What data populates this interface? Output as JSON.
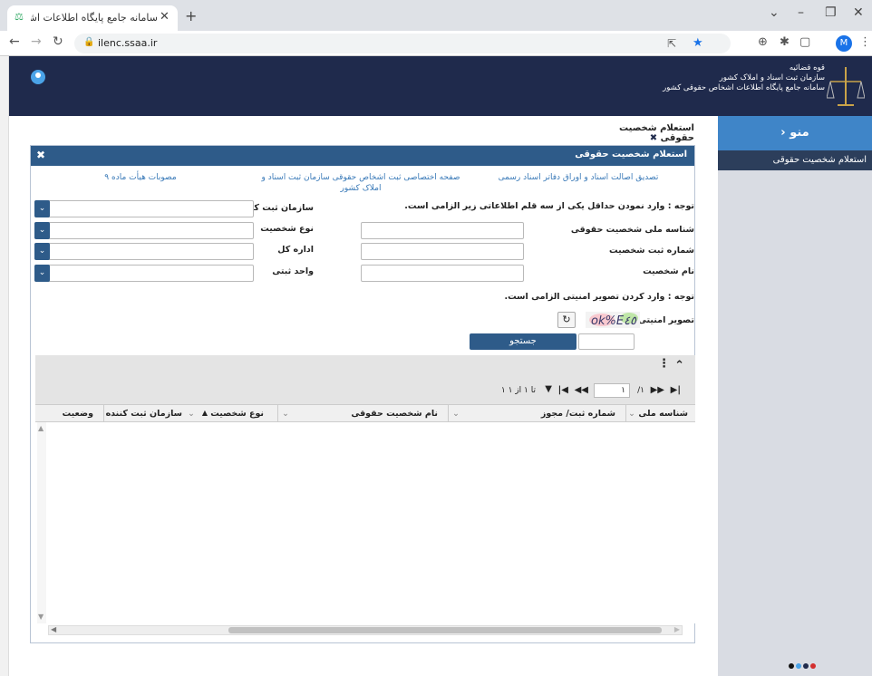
{
  "browser": {
    "tab_title": "سامانه جامع پایگاه اطلاعات اشخاص",
    "url": "ilenc.ssaa.ir",
    "profile_initial": "M"
  },
  "header": {
    "org_line1": "قوه قضائیه",
    "org_line2": "سازمان ثبت اسناد و املاک کشور",
    "org_line3": "سامانه جامع پایگاه اطلاعات اشخاص حقوقی کشور"
  },
  "sidebar": {
    "menu_title": "منو",
    "items": [
      {
        "label": "استعلام شخصیت حقوقی"
      }
    ],
    "dot_colors": [
      "#111111",
      "#4aa3e8",
      "#1f2a4c",
      "#d32f2f"
    ]
  },
  "page_tab": {
    "label": "استعلام شخصیت حقوقی"
  },
  "dialog": {
    "title": "استعلام شخصیت حقوقی",
    "links": [
      {
        "label": "تصدیق اصالت اسناد و اوراق دفاتر اسناد رسمی"
      },
      {
        "label": "صفحه اختصاصی ثبت اشخاص حقوقی سازمان ثبت اسناد و املاک کشور"
      },
      {
        "label": "مصوبات هیأت ماده ۹"
      }
    ],
    "notice1": "توجه : وارد نمودن حداقل یکی از سه قلم اطلاعاتی زیر الزامی است.",
    "fields_right": [
      {
        "label": "شناسه ملی شخصیت حقوقی",
        "value": ""
      },
      {
        "label": "شماره ثبت شخصیت",
        "value": ""
      },
      {
        "label": "نام شخصیت",
        "value": ""
      }
    ],
    "fields_left": [
      {
        "label": "سازمان ثبت کننده",
        "value": ""
      },
      {
        "label": "نوع شخصیت",
        "value": ""
      },
      {
        "label": "اداره کل",
        "value": ""
      },
      {
        "label": "واحد ثبتی",
        "value": ""
      }
    ],
    "notice2": "توجه : وارد کردن تصویر امنیتی الزامی است.",
    "captcha_label": "تصویر امنیتی",
    "captcha_text": "ok%E٤٥",
    "search_button": "جستجو"
  },
  "grid": {
    "page_value": "۱",
    "page_of": "/۱",
    "range_text": "۱ تا ۱ از ۱",
    "columns": [
      {
        "label": "شناسه ملی"
      },
      {
        "label": "شماره ثبت/ مجوز"
      },
      {
        "label": "نام شخصیت حقوقی"
      },
      {
        "label": "نوع شخصیت"
      },
      {
        "label": "سازمان ثبت کننده"
      },
      {
        "label": "وضعیت"
      }
    ]
  }
}
